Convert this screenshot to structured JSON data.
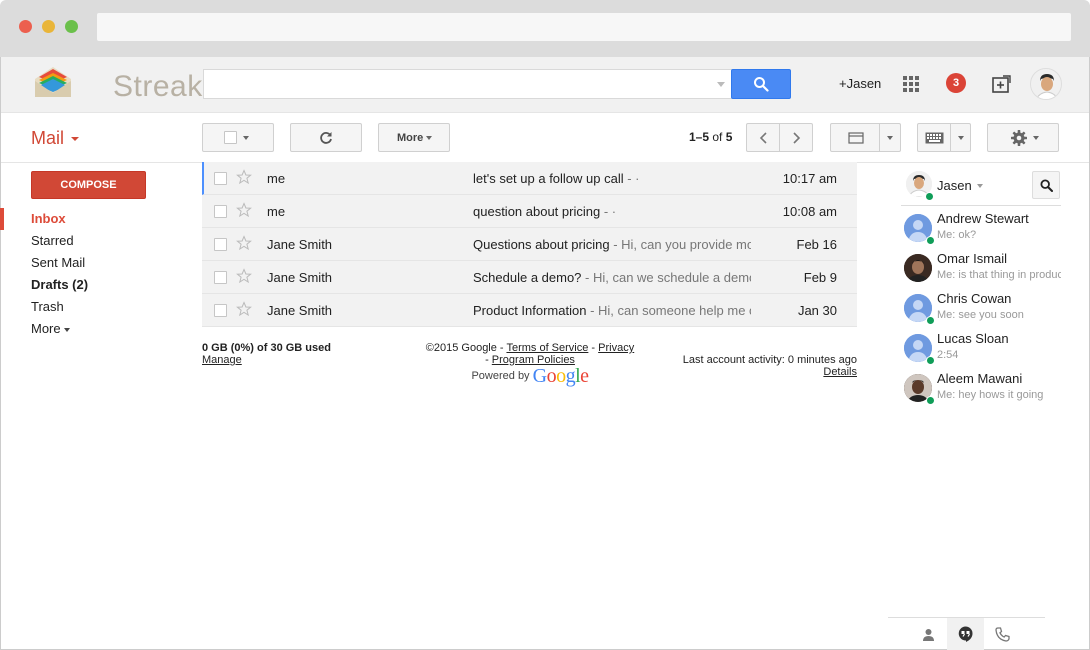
{
  "brand": {
    "name": "Streak"
  },
  "header": {
    "search_placeholder": "",
    "user_link": "+Jasen",
    "notification_count": "3"
  },
  "toolbar": {
    "mail_label": "Mail",
    "more_label": "More",
    "pager_range": "1–5",
    "pager_of": "of",
    "pager_total": "5"
  },
  "sidebar": {
    "compose_label": "COMPOSE",
    "items": [
      {
        "label": "Inbox",
        "active": true
      },
      {
        "label": "Starred"
      },
      {
        "label": "Sent Mail"
      },
      {
        "label": "Drafts (2)",
        "bold": true
      },
      {
        "label": "Trash"
      },
      {
        "label": "More"
      }
    ]
  },
  "emails": [
    {
      "sender": "me",
      "subject": "let's set up a follow up call",
      "snippet": " - ·",
      "date": "10:17 am"
    },
    {
      "sender": "me",
      "subject": "question about pricing",
      "snippet": " - ·",
      "date": "10:08 am"
    },
    {
      "sender": "Jane Smith",
      "subject": "Questions about pricing",
      "snippet": " - Hi, can you provide mo",
      "date": "Feb 16"
    },
    {
      "sender": "Jane Smith",
      "subject": "Schedule a demo?",
      "snippet": " - Hi, can we schedule a demo",
      "date": "Feb 9"
    },
    {
      "sender": "Jane Smith",
      "subject": "Product Information",
      "snippet": " - Hi, can someone help me c",
      "date": "Jan 30"
    }
  ],
  "footer": {
    "storage": "0 GB (0%) of 30 GB used",
    "manage": "Manage",
    "copyright": "©2015 Google - ",
    "terms": "Terms of Service",
    "sep1": " - ",
    "privacy": "Privacy",
    "sep2": "- ",
    "policies": "Program Policies",
    "powered_by": "Powered by",
    "last_activity": "Last account activity: 0 minutes ago",
    "details": "Details"
  },
  "hangouts": {
    "me_name": "Jasen",
    "contacts": [
      {
        "name": "Andrew Stewart",
        "status": "Me: ok?"
      },
      {
        "name": "Omar Ismail",
        "status": "Me: is that thing in production"
      },
      {
        "name": "Chris Cowan",
        "status": "Me: see you soon"
      },
      {
        "name": "Lucas Sloan",
        "status": "2:54"
      },
      {
        "name": "Aleem Mawani",
        "status": "Me: hey hows it going"
      }
    ]
  },
  "colors": {
    "accent_red": "#d14836",
    "search_blue": "#4a8af4",
    "online_green": "#0f9d58"
  }
}
